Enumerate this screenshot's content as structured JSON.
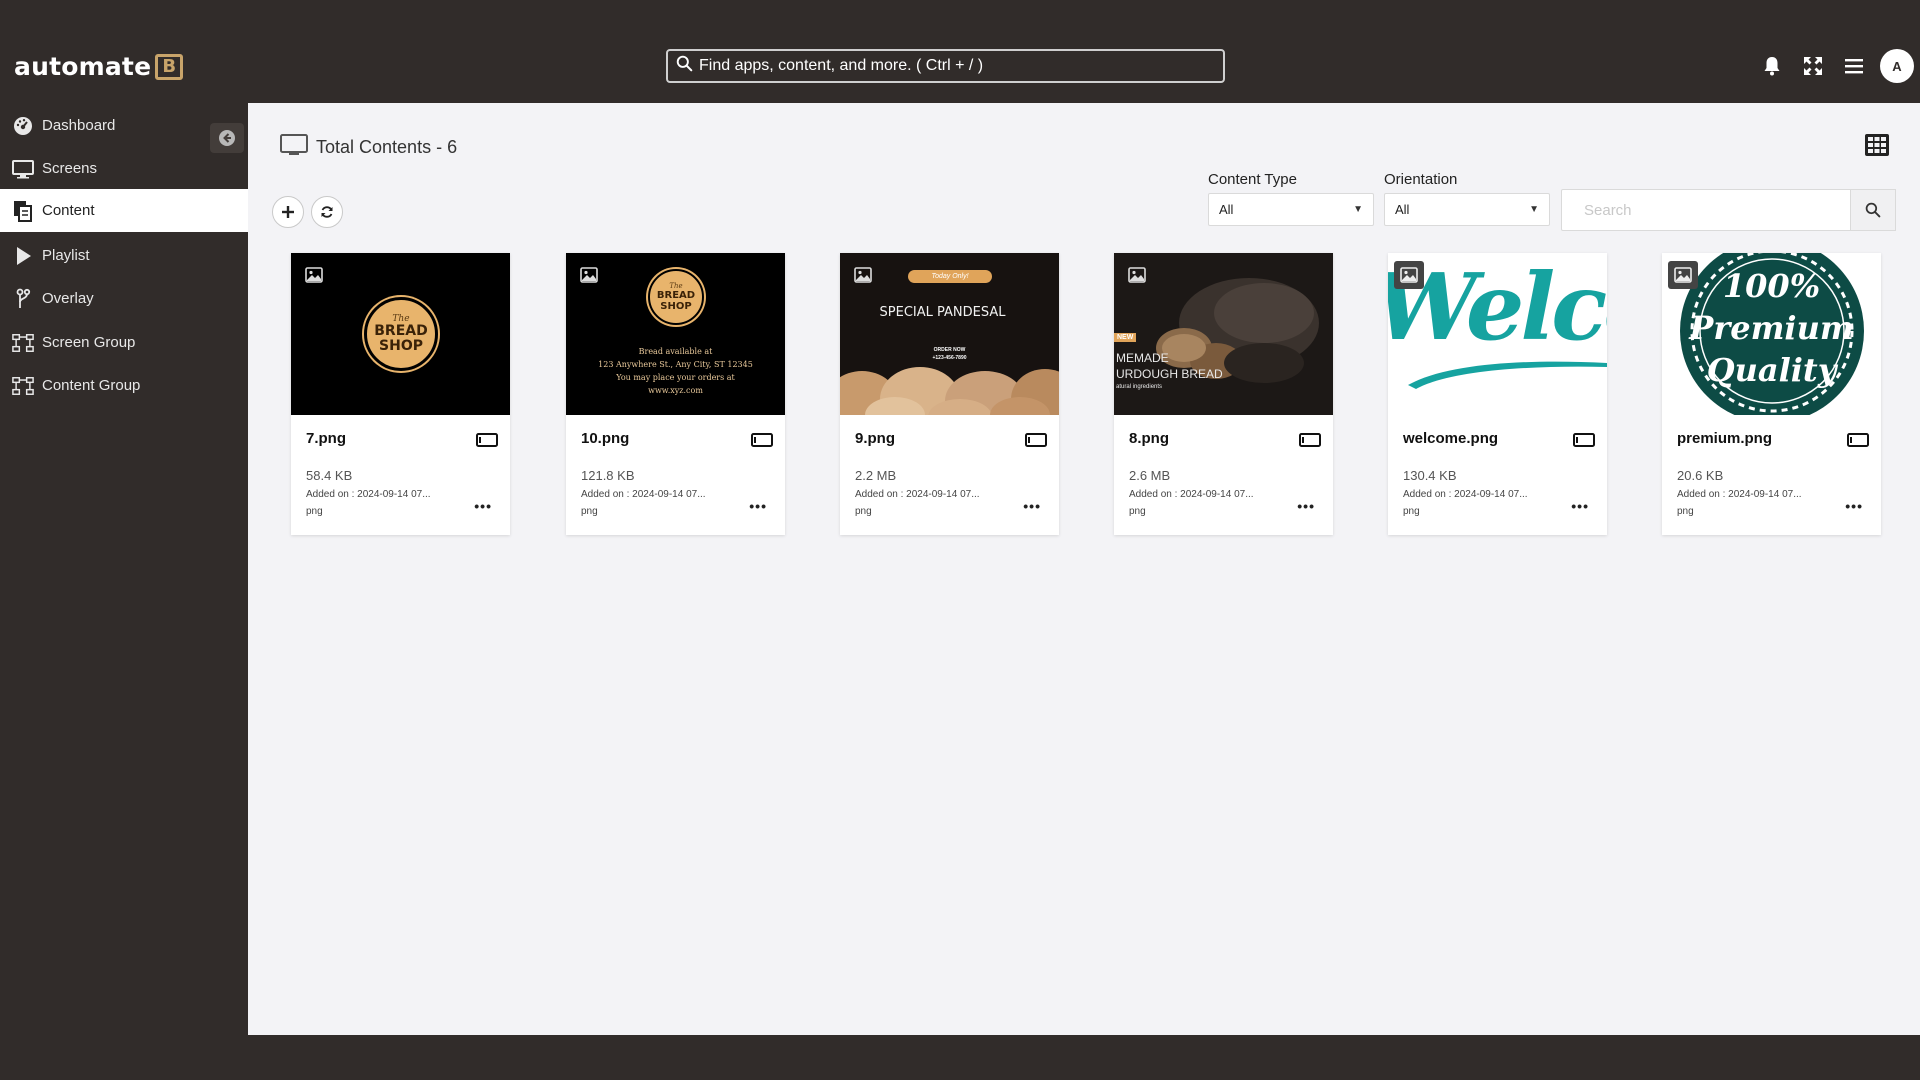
{
  "app": {
    "logo_text": "automate",
    "logo_mark": "B",
    "search_placeholder": "Find apps, content, and more. ( Ctrl + / )",
    "avatar_initial": "A"
  },
  "header_icons": [
    "bell-icon",
    "fullscreen-icon",
    "menu-icon"
  ],
  "sidebar": {
    "items": [
      {
        "label": "Dashboard",
        "icon": "dashboard-icon"
      },
      {
        "label": "Screens",
        "icon": "monitor-icon"
      },
      {
        "label": "Content",
        "icon": "content-icon",
        "active": true
      },
      {
        "label": "Playlist",
        "icon": "play-icon"
      },
      {
        "label": "Overlay",
        "icon": "overlay-icon"
      },
      {
        "label": "Screen Group",
        "icon": "screen-group-icon"
      },
      {
        "label": "Content Group",
        "icon": "content-group-icon"
      }
    ]
  },
  "main": {
    "title": "Total Contents - 6",
    "filters": {
      "content_type_label": "Content Type",
      "content_type_value": "All",
      "orientation_label": "Orientation",
      "orientation_value": "All",
      "search_placeholder": "Search"
    }
  },
  "cards": [
    {
      "name": "7.png",
      "size": "58.4 KB",
      "added": "Added on : 2024-09-14 07...",
      "type": "png",
      "thumb": {
        "brand_small": "The",
        "brand_line1": "BREAD",
        "brand_line2": "SHOP"
      }
    },
    {
      "name": "10.png",
      "size": "121.8 KB",
      "added": "Added on : 2024-09-14 07...",
      "type": "png",
      "thumb": {
        "brand_small": "The",
        "brand_line1": "BREAD",
        "brand_line2": "SHOP",
        "line1": "Bread available at",
        "line2": "123 Anywhere St., Any City, ST 12345",
        "line3": "You may place your orders at",
        "line4": "www.xyz.com"
      }
    },
    {
      "name": "9.png",
      "size": "2.2 MB",
      "added": "Added on : 2024-09-14 07...",
      "type": "png",
      "thumb": {
        "pill": "Today Only!",
        "headline": "SPECIAL PANDESAL",
        "small1": "ORDER NOW",
        "small2": "+123-456-7890"
      }
    },
    {
      "name": "8.png",
      "size": "2.6 MB",
      "added": "Added on : 2024-09-14 07...",
      "type": "png",
      "thumb": {
        "tag": "NEW",
        "line1": "MEMADE",
        "line2": "URDOUGH BREAD",
        "line3": "atural ingredients"
      }
    },
    {
      "name": "welcome.png",
      "size": "130.4 KB",
      "added": "Added on : 2024-09-14 07...",
      "type": "png",
      "thumb": {
        "script": "Welcom"
      }
    },
    {
      "name": "premium.png",
      "size": "20.6 KB",
      "added": "Added on : 2024-09-14 07...",
      "type": "png",
      "thumb": {
        "line1": "100%",
        "line2": "Premium",
        "line3": "Quality"
      }
    }
  ],
  "colors": {
    "chrome": "#312c2a",
    "main_bg": "#f3f3f6",
    "bread_gold": "#e8b46c",
    "teal": "#16a3a0",
    "dark_green": "#0d4b45"
  }
}
